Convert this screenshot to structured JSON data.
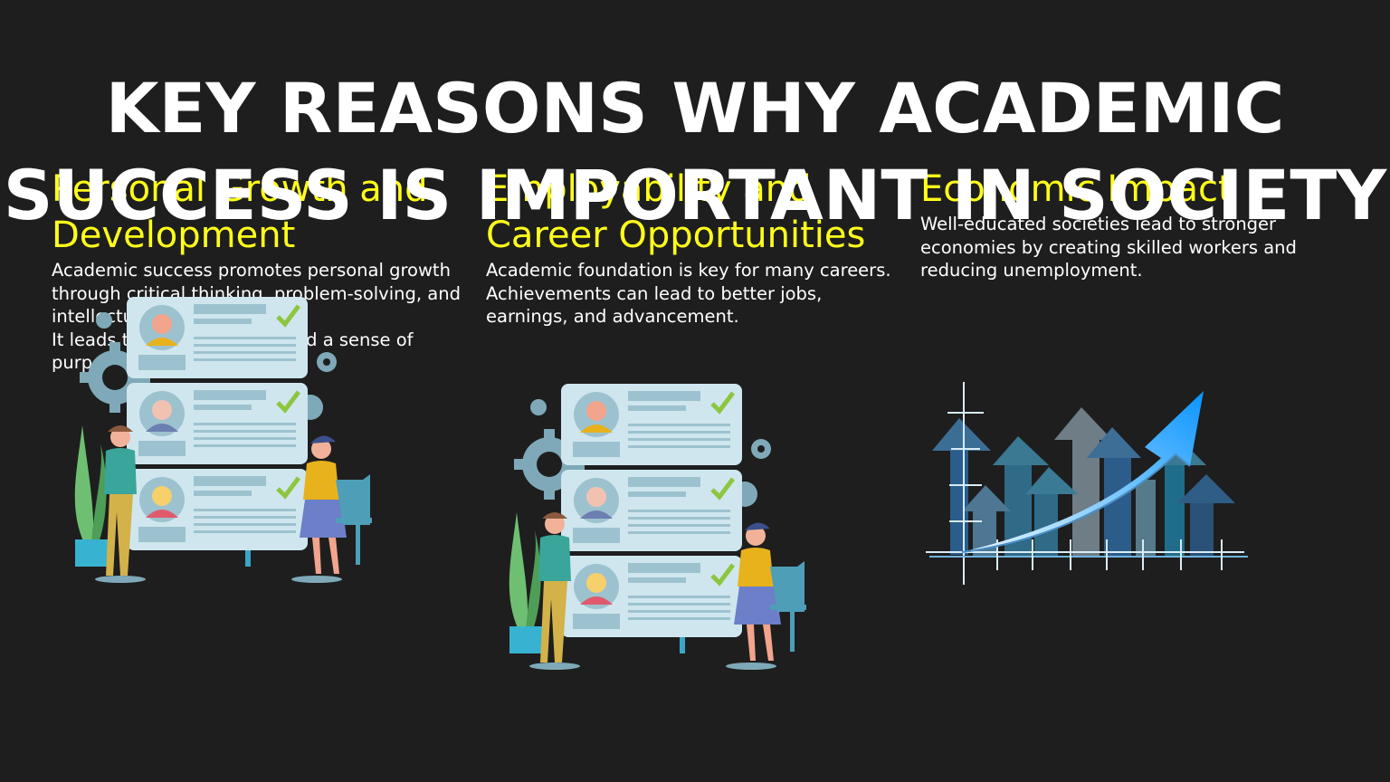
{
  "slide": {
    "title": "KEY REASONS WHY ACADEMIC SUCCESS IS IMPORTANT IN SOCIETY",
    "columns": [
      {
        "heading": "Personal Growth and Development",
        "body": "Academic success promotes personal growth through critical thinking, problem-solving, and intellectual curiosity.\nIt leads to self-confidence and a sense of purpose.",
        "image": "resume-candidates-illustration"
      },
      {
        "heading": "Employability and Career Opportunities",
        "body": "Academic foundation is key for many careers.\nAchievements can lead to better jobs, earnings, and advancement.",
        "image": "resume-candidates-illustration"
      },
      {
        "heading": "Economic Impact",
        "body": "Well-educated societies lead to stronger economies by creating skilled workers and reducing unemployment.",
        "image": "rising-arrow-bar-chart-illustration"
      }
    ]
  },
  "colors": {
    "background": "#1e1e1e",
    "title": "#ffffff",
    "heading": "#ffff1a",
    "body": "#ffffff",
    "card": "#cfe6ee",
    "accent_blue": "#1aa7ff"
  }
}
